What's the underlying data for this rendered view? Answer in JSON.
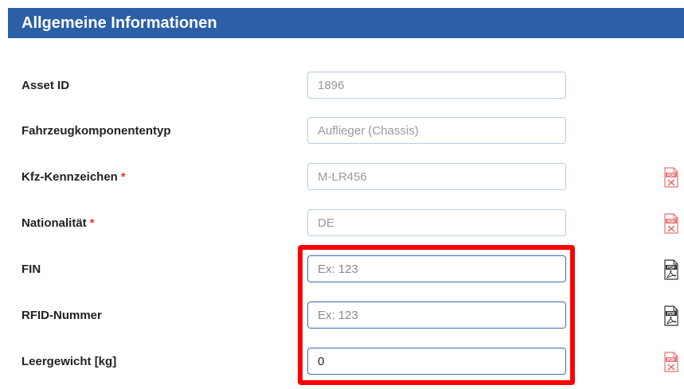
{
  "header": {
    "title": "Allgemeine Informationen"
  },
  "required_marker": "*",
  "fields": [
    {
      "label": "Asset ID",
      "value": "1896",
      "placeholder": "",
      "required": false
    },
    {
      "label": "Fahrzeugkomponententyp",
      "value": "Auflieger (Chassis)",
      "placeholder": "",
      "required": false
    },
    {
      "label": "Kfz-Kennzeichen",
      "value": "M-LR456",
      "placeholder": "",
      "required": true,
      "pdf_icon": "pdf-missing-icon"
    },
    {
      "label": "Nationalität",
      "value": "DE",
      "placeholder": "",
      "required": true,
      "pdf_icon": "pdf-missing-icon"
    },
    {
      "label": "FIN",
      "value": "",
      "placeholder": "Ex: 123",
      "required": false,
      "pdf_icon": "pdf-document-icon"
    },
    {
      "label": "RFID-Nummer",
      "value": "",
      "placeholder": "Ex: 123",
      "required": false,
      "pdf_icon": "pdf-document-icon"
    },
    {
      "label": "Leergewicht [kg]",
      "value": "0",
      "placeholder": "",
      "required": false,
      "pdf_icon": "pdf-missing-icon"
    }
  ],
  "colors": {
    "header_bg": "#2b5fa6",
    "required": "#e53935",
    "highlight": "#ff0000",
    "pdf_missing": "#e57373",
    "pdf_document": "#333333"
  }
}
